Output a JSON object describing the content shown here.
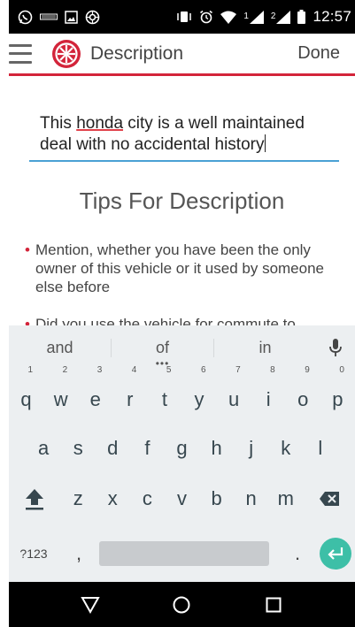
{
  "status_bar": {
    "time": "12:57",
    "sim1": "1",
    "sim2": "2",
    "icons": [
      "whatsapp-icon",
      "ndtv-icon",
      "gallery-icon",
      "settings-icon",
      "vibrate-icon",
      "alarm-icon",
      "wifi-icon",
      "signal-icon",
      "battery-icon"
    ]
  },
  "header": {
    "title": "Description",
    "done_label": "Done",
    "accent_color": "#d3243a"
  },
  "editor": {
    "text_before": "This ",
    "misspelled_word": "honda",
    "text_after": " city is a well maintained deal with no accidental history",
    "underline_color": "#4aa1d4"
  },
  "tips": {
    "title": "Tips For Description",
    "items": [
      "Mention, whether you have been the only owner of this vehicle or it used by someone else before",
      "Did you use the vehicle for commute to"
    ]
  },
  "keyboard": {
    "suggestions": [
      "and",
      "of",
      "in"
    ],
    "row1": [
      {
        "key": "q",
        "hint": "1"
      },
      {
        "key": "w",
        "hint": "2"
      },
      {
        "key": "e",
        "hint": "3"
      },
      {
        "key": "r",
        "hint": "4"
      },
      {
        "key": "t",
        "hint": "5"
      },
      {
        "key": "y",
        "hint": "6"
      },
      {
        "key": "u",
        "hint": "7"
      },
      {
        "key": "i",
        "hint": "8"
      },
      {
        "key": "o",
        "hint": "9"
      },
      {
        "key": "p",
        "hint": "0"
      }
    ],
    "row2": [
      "a",
      "s",
      "d",
      "f",
      "g",
      "h",
      "j",
      "k",
      "l"
    ],
    "row3": [
      "z",
      "x",
      "c",
      "v",
      "b",
      "n",
      "m"
    ],
    "symbols_label": "?123",
    "comma": ",",
    "period": ".",
    "enter_color": "#3dbfa7"
  },
  "nav_bar": {
    "buttons": [
      "back-icon",
      "home-icon",
      "recents-icon"
    ]
  }
}
